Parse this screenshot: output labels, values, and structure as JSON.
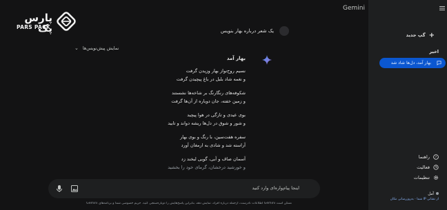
{
  "brand": {
    "name": "پارس پک",
    "sub": "PARS PACK"
  },
  "app": {
    "title": "Gemini"
  },
  "conversation": {
    "user_prompt": "یک شعر درباره بهار بنویس",
    "show_drafts": "نمایش پیش‌نویس‌ها",
    "response_title": "بهار آمد",
    "stanzas": [
      [
        "نسیم روح‌نواز بهار وزیدن گرفت",
        "و نغمه شاد بلبل در باغ پیچیدن گرفت"
      ],
      [
        "شکوفه‌های رنگارنگ بر شاخه‌ها نشستند",
        "و زمین خفته، جان دوباره از آن‌ها گرفت"
      ],
      [
        "بوی عیدی و تازگی در هوا پیچید",
        "و شور و شوق در دل‌ها ریشه دواند و تابید"
      ],
      [
        "سفره هفت‌سین، با رنگ و بوی بهار",
        "آراسته شد و شادی به ارمغان آورد"
      ],
      [
        "آسمان صاف و آبی، گویی لبخند زد",
        "و خورشید درخشان، گرمای خود را بخشید"
      ]
    ]
  },
  "input": {
    "placeholder": "اینجا پیام‌واره‌ای وارد کنید"
  },
  "footer": {
    "text": "ممکن است Gemini اطلاعات نادرست، ازجمله درباره افراد، نمایش دهد، بنابراین پاسخ‌هایش را دوباره‌سنجی کنید. حریم خصوصی شما و برنامه‌های Gemini"
  },
  "sidebar": {
    "new_chat": "گپ جدید",
    "recent_heading": "اخیر",
    "recent_items": [
      {
        "label": "بهار آمد، دل‌ها شاد شد"
      }
    ],
    "help": "راهنما",
    "activity": "فعالیت",
    "settings": "تنظیمات",
    "location_name": "آمل",
    "location_sub": "از نشانی IP شما · به‌روزرسانی مکان"
  },
  "colors": {
    "accent": "#0b57d0",
    "background": "#131314",
    "sidebar": "#1e1f20"
  }
}
